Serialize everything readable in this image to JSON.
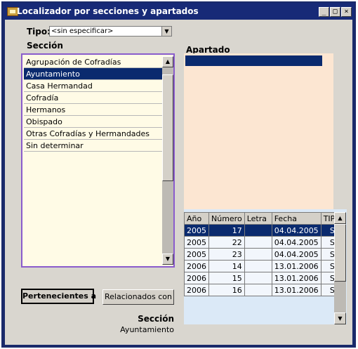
{
  "window": {
    "title": "Localizador por secciones y apartados",
    "minimize": "_",
    "maximize": "□",
    "close": "×"
  },
  "tipo": {
    "label": "Tipo:",
    "value": "<sin especificar>"
  },
  "seccion": {
    "header": "Sección",
    "items": [
      "Agrupación de Cofradías",
      "Ayuntamiento",
      "Casa Hermandad",
      "Cofradía",
      "Hermanos",
      "Obispado",
      "Otras Cofradías y Hermandades",
      "Sin determinar"
    ],
    "selected_index": 1
  },
  "apartado": {
    "header": "Apartado"
  },
  "buttons": {
    "pertenecientes": "Pertenecientes a",
    "relacionados": "Relacionados con"
  },
  "footer": {
    "label": "Sección",
    "value": "Ayuntamiento"
  },
  "grid": {
    "columns": [
      "Año",
      "Número",
      "Letra",
      "Fecha",
      "TIPO"
    ],
    "rows": [
      [
        "2005",
        "17",
        "",
        "04.04.2005",
        "S"
      ],
      [
        "2005",
        "22",
        "",
        "04.04.2005",
        "S"
      ],
      [
        "2005",
        "23",
        "",
        "04.04.2005",
        "S"
      ],
      [
        "2006",
        "14",
        "",
        "13.01.2006",
        "S"
      ],
      [
        "2006",
        "15",
        "",
        "13.01.2006",
        "S"
      ],
      [
        "2006",
        "16",
        "",
        "13.01.2006",
        "S"
      ]
    ],
    "selected_index": 0
  },
  "icons": {
    "window": "folder-icon",
    "combo": "chevron-down-icon",
    "scroll_up": "arrow-up-icon",
    "scroll_down": "arrow-down-icon"
  }
}
